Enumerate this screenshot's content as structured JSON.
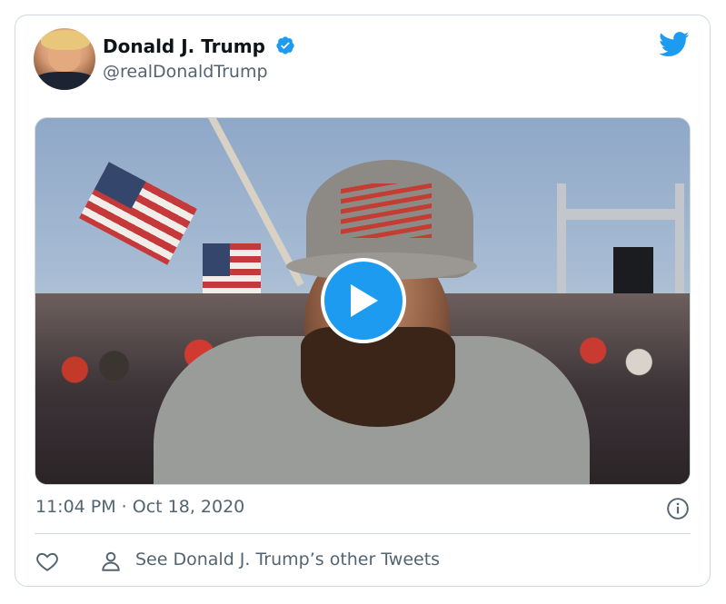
{
  "tweet": {
    "author_name": "Donald J. Trump",
    "author_handle": "@realDonaldTrump",
    "timestamp": "11:04 PM · Oct 18, 2020",
    "other_tweets_link": "See Donald J. Trump’s other Tweets"
  },
  "colors": {
    "twitter_blue": "#1d9bf0",
    "secondary_text": "#536471",
    "border": "#cfd9de"
  },
  "icons": {
    "verified": "verified-badge-icon",
    "logo": "twitter-bird-icon",
    "play": "play-icon",
    "info": "info-icon",
    "like": "heart-icon",
    "profile": "person-icon"
  }
}
